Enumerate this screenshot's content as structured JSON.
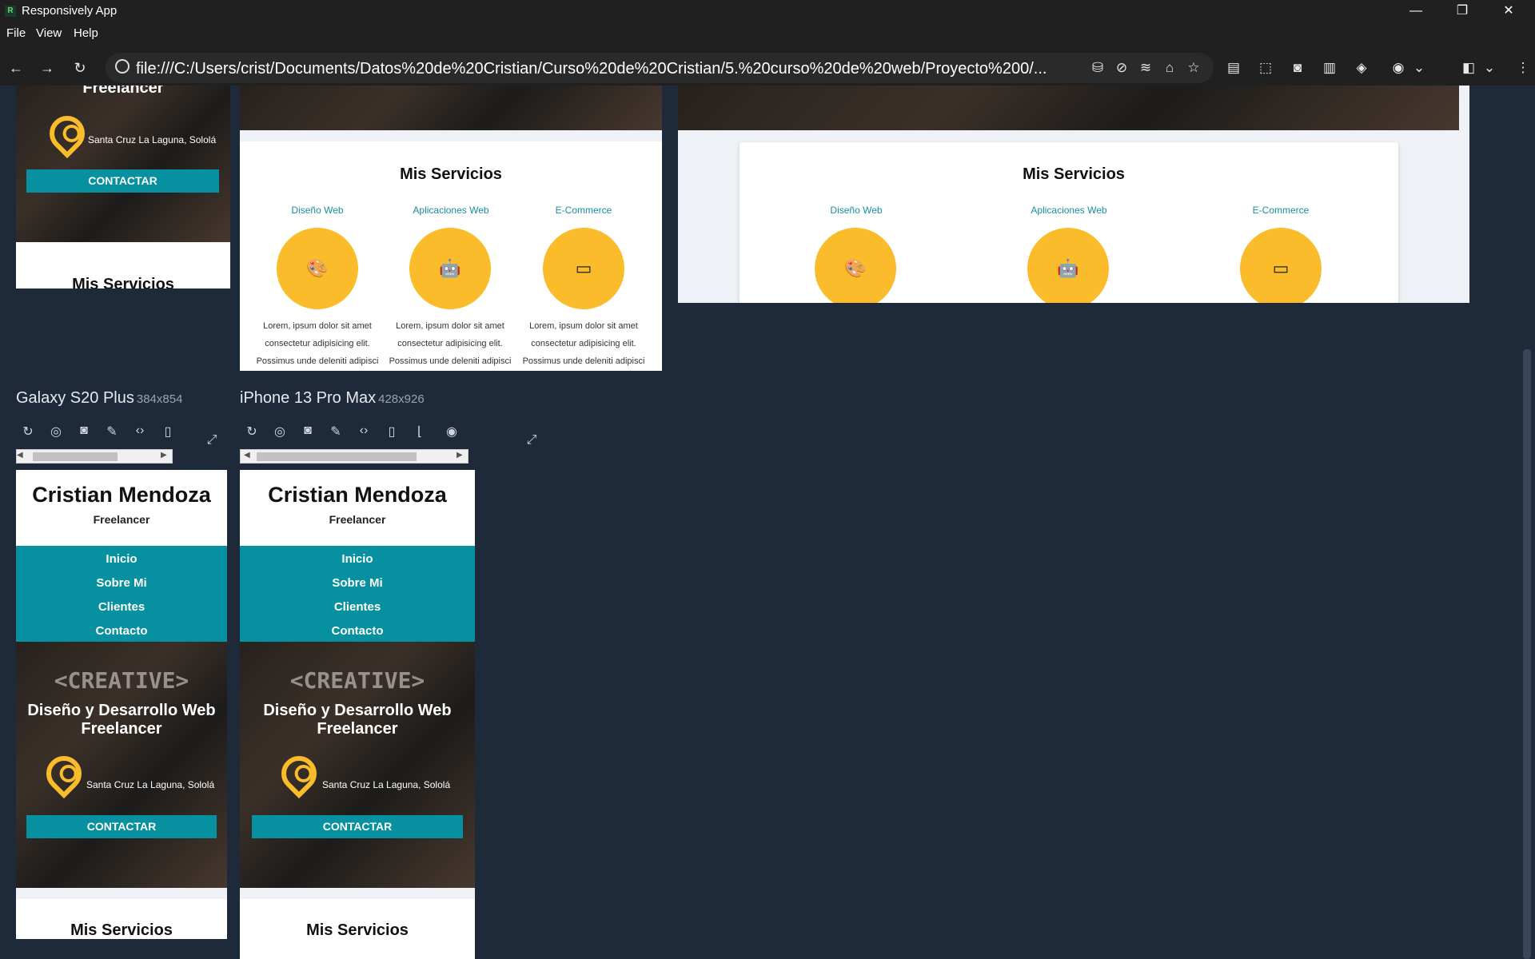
{
  "window": {
    "title": "Responsively App",
    "minimize": "—",
    "restore": "❐",
    "close": "✕"
  },
  "menu": {
    "file": "File",
    "view": "View",
    "help": "Help"
  },
  "toolbar": {
    "back": "←",
    "forward": "→",
    "reload": "↻",
    "url": "file:///C:/Users/crist/Documents/Datos%20de%20Cristian/Curso%20de%20Cristian/5.%20curso%20de%20web/Proyecto%200/...",
    "more": "⋮"
  },
  "site": {
    "name": "Cristian Mendoza",
    "role": "Freelancer",
    "nav": [
      "Inicio",
      "Sobre Mi",
      "Clientes",
      "Contacto"
    ],
    "creative": "<CREATIVE>",
    "hero_title_line1": "Diseño y Desarrollo Web",
    "hero_title_line2": "Freelancer",
    "location": "Santa Cruz La Laguna, Sololá",
    "cta": "CONTACTAR",
    "services_title": "Mis Servicios",
    "services": [
      {
        "label": "Diseño Web",
        "icon": "palette-icon"
      },
      {
        "label": "Aplicaciones Web",
        "icon": "android-apple-icon"
      },
      {
        "label": "E-Commerce",
        "icon": "credit-card-icon"
      }
    ],
    "lorem_1": "Lorem, ipsum dolor sit amet",
    "lorem_2": "consectetur adipisicing elit.",
    "lorem_3": "Possimus unde deleniti adipisci"
  },
  "devices": [
    {
      "name": "Galaxy S20 Plus",
      "size": "384x854"
    },
    {
      "name": "iPhone 13 Pro Max",
      "size": "428x926"
    }
  ],
  "colors": {
    "accent": "#07909f",
    "yellow": "#fbbc2b",
    "background": "#1e2939"
  }
}
